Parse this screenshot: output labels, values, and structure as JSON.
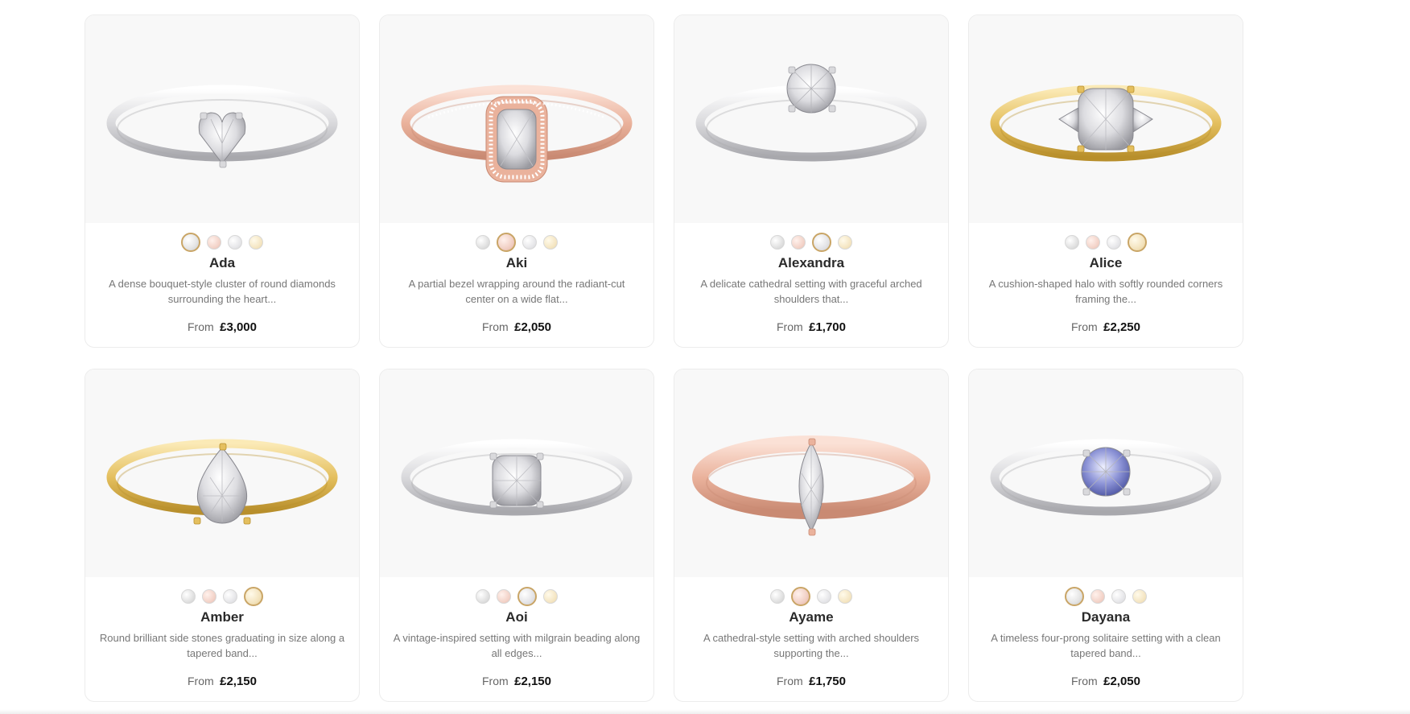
{
  "colors": {
    "active_ring": "#c9a566",
    "white_gold": "#dcdcdc",
    "rose_gold": "#f1cfc4",
    "platinum": "#e3e3e6",
    "yellow_gold": "#f3e3be"
  },
  "products": [
    {
      "name": "Ada",
      "description": "A dense bouquet-style cluster of round diamonds surrounding the heart...",
      "from_label": "From",
      "price": "£3,000",
      "metal": "white",
      "stone": "heart",
      "swatches": [
        "white",
        "rose",
        "plat",
        "yellow"
      ],
      "active_swatch": 0
    },
    {
      "name": "Aki",
      "description": "A partial bezel wrapping around the radiant-cut center on a wide flat...",
      "from_label": "From",
      "price": "£2,050",
      "metal": "rose",
      "stone": "halo-cushion",
      "swatches": [
        "white",
        "rose",
        "plat",
        "yellow"
      ],
      "active_swatch": 1
    },
    {
      "name": "Alexandra",
      "description": "A delicate cathedral setting with graceful arched shoulders that...",
      "from_label": "From",
      "price": "£1,700",
      "metal": "white",
      "stone": "round",
      "swatches": [
        "white",
        "rose",
        "plat",
        "yellow"
      ],
      "active_swatch": 2
    },
    {
      "name": "Alice",
      "description": "A cushion-shaped halo with softly rounded corners framing the...",
      "from_label": "From",
      "price": "£2,250",
      "metal": "yellow",
      "stone": "cushion-trio",
      "swatches": [
        "white",
        "rose",
        "plat",
        "yellow"
      ],
      "active_swatch": 3
    },
    {
      "name": "Amber",
      "description": "Round brilliant side stones graduating in size along a tapered band...",
      "from_label": "From",
      "price": "£2,150",
      "metal": "yellow",
      "stone": "pear",
      "swatches": [
        "white",
        "rose",
        "plat",
        "yellow"
      ],
      "active_swatch": 3
    },
    {
      "name": "Aoi",
      "description": "A vintage-inspired setting with milgrain beading along all edges...",
      "from_label": "From",
      "price": "£2,150",
      "metal": "white",
      "stone": "cushion",
      "swatches": [
        "white",
        "rose",
        "plat",
        "yellow"
      ],
      "active_swatch": 2
    },
    {
      "name": "Ayame",
      "description": "A cathedral-style setting with arched shoulders supporting the...",
      "from_label": "From",
      "price": "£1,750",
      "metal": "rose",
      "stone": "marquise",
      "swatches": [
        "white",
        "rose",
        "plat",
        "yellow"
      ],
      "active_swatch": 1
    },
    {
      "name": "Dayana",
      "description": "A timeless four-prong solitaire setting with a clean tapered band...",
      "from_label": "From",
      "price": "£2,050",
      "metal": "white",
      "stone": "round-blue",
      "swatches": [
        "white",
        "rose",
        "plat",
        "yellow"
      ],
      "active_swatch": 0
    }
  ]
}
